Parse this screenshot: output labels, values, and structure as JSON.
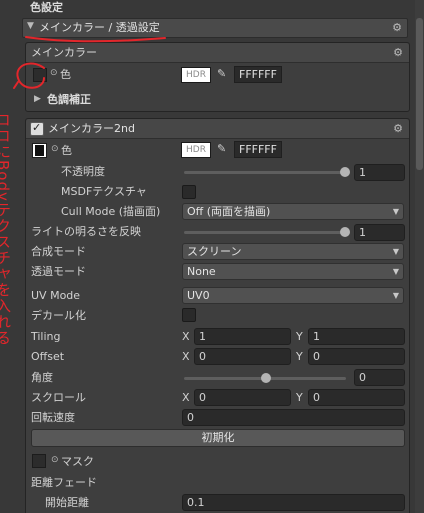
{
  "title": "色設定",
  "header_foldout": {
    "label": "メインカラー / 透過設定"
  },
  "main_color_section": {
    "title": "メインカラー",
    "color_label": "色",
    "hdr_label": "HDR",
    "hex": "FFFFFF",
    "sub_foldout": "色調補正"
  },
  "main_color_2nd": {
    "title": "メインカラー2nd",
    "color_label": "色",
    "hdr_label": "HDR",
    "hex": "FFFFFF",
    "opacity_label": "不透明度",
    "opacity_value": "1",
    "msdf_label": "MSDFテクスチャ",
    "cull_label": "Cull Mode (描画面)",
    "cull_value": "Off (両面を描画)",
    "light_label": "ライトの明るさを反映",
    "light_value": "1",
    "blend_label": "合成モード",
    "blend_value": "スクリーン",
    "transparent_label": "透過モード",
    "transparent_value": "None",
    "uv_label": "UV Mode",
    "uv_value": "UV0",
    "decal_label": "デカール化",
    "tiling_label": "Tiling",
    "tiling_x": "1",
    "tiling_y": "1",
    "offset_label": "Offset",
    "offset_x": "0",
    "offset_y": "0",
    "angle_label": "角度",
    "angle_value": "0",
    "scroll_label": "スクロール",
    "scroll_x": "0",
    "scroll_y": "0",
    "rotation_label": "回転速度",
    "rotation_value": "0",
    "reset_button": "初期化",
    "mask_label": "マスク",
    "dist_fade_label": "距離フェード",
    "start_dist_label": "開始距離",
    "start_dist_value": "0.1",
    "x_label": "X",
    "y_label": "Y"
  },
  "annotation": {
    "text": "ココにBodyテクスチャを入れる",
    "color": "#e3262b"
  }
}
